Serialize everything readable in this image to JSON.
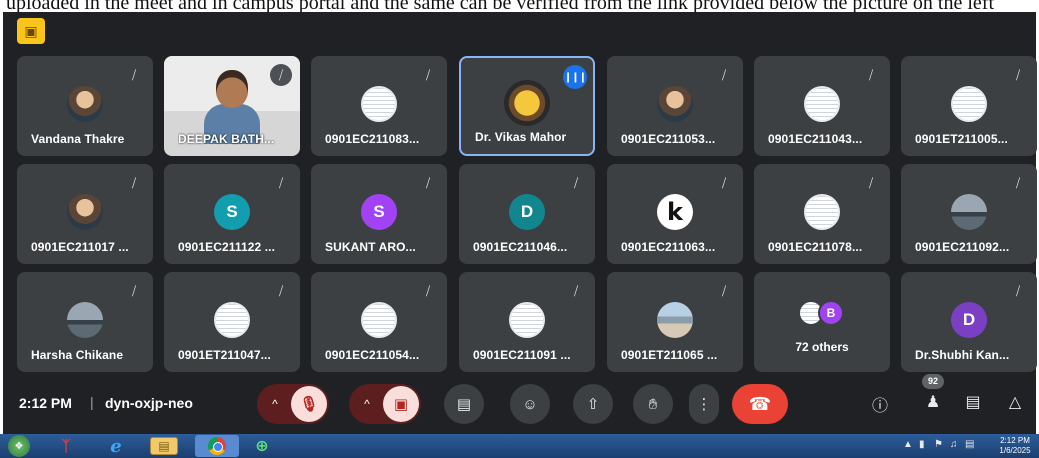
{
  "top_caption": "uploaded in the meet and in campus portal and the same can be verified from the link provided below the picture on the left",
  "meeting": {
    "time": "2:12 PM",
    "separator": "|",
    "code": "dyn-oxjp-neo",
    "people_count": "92"
  },
  "tiles": [
    {
      "name": "Vandana Thakre",
      "avatar": "photo",
      "mic": "muted"
    },
    {
      "name": "DEEPAK BATH...",
      "avatar": "video",
      "mic": "muted-solid"
    },
    {
      "name": "0901EC211083...",
      "avatar": "doc",
      "mic": "muted"
    },
    {
      "name": "Dr. Vikas Mahor",
      "avatar": "yellow",
      "mic": "speaking"
    },
    {
      "name": "0901EC211053...",
      "avatar": "photo",
      "mic": "muted"
    },
    {
      "name": "0901EC211043...",
      "avatar": "doc",
      "mic": "muted"
    },
    {
      "name": "0901ET211005...",
      "avatar": "doc",
      "mic": "muted"
    },
    {
      "name": "0901EC211017 ...",
      "avatar": "photo",
      "mic": "muted"
    },
    {
      "name": "0901EC211122 ...",
      "avatar": "letter",
      "letter": "S",
      "color": "#129eaf",
      "mic": "muted"
    },
    {
      "name": "SUKANT ARO...",
      "avatar": "letter",
      "letter": "S",
      "color": "#a142f4",
      "mic": "muted"
    },
    {
      "name": "0901EC211046...",
      "avatar": "letter",
      "letter": "D",
      "color": "#12868f",
      "mic": "muted"
    },
    {
      "name": "0901EC211063...",
      "avatar": "k",
      "letter": "k",
      "mic": "muted"
    },
    {
      "name": "0901EC211078...",
      "avatar": "doc",
      "mic": "muted"
    },
    {
      "name": "0901EC211092...",
      "avatar": "sky",
      "mic": "muted"
    },
    {
      "name": "Harsha Chikane",
      "avatar": "sky",
      "mic": "muted"
    },
    {
      "name": "0901ET211047...",
      "avatar": "doc",
      "mic": "muted"
    },
    {
      "name": "0901EC211054...",
      "avatar": "doc",
      "mic": "muted"
    },
    {
      "name": "0901EC211091 ...",
      "avatar": "doc",
      "mic": "muted"
    },
    {
      "name": "0901ET211065 ...",
      "avatar": "campus",
      "mic": "muted"
    },
    {
      "name": "72 others",
      "avatar": "others",
      "letter": "B",
      "mic": "none"
    },
    {
      "name": "Dr.Shubhi Kan...",
      "avatar": "letter",
      "letter": "D",
      "color": "#7b3fc4",
      "mic": "muted"
    }
  ],
  "controls": {
    "mic_chevron": "^",
    "mic_icon": "mic-off-icon",
    "cam_chevron": "^",
    "cam_icon": "camera-off-icon",
    "captions_icon": "captions-icon",
    "emoji_icon": "emoji-icon",
    "present_icon": "present-screen-icon",
    "hand_icon": "raise-hand-icon",
    "more_icon": "more-options-icon",
    "end_icon": "end-call-icon",
    "info_icon": "info-icon",
    "people_icon": "people-icon",
    "chat_icon": "chat-icon",
    "activities_icon": "activities-icon",
    "colors": {
      "danger_bg": "#5c1e1e",
      "danger_chip": "#f9dedc",
      "end_call": "#ea4335",
      "accent": "#8ab4f8",
      "tile_bg": "#3c4043",
      "meet_bg": "#202124"
    }
  },
  "taskbar": {
    "icons": [
      "start-orb-icon",
      "pdf-icon",
      "internet-explorer-icon",
      "folder-icon",
      "chrome-icon",
      "edge-icon"
    ],
    "clock_time": "2:12 PM",
    "clock_date": "1/6/2025"
  }
}
